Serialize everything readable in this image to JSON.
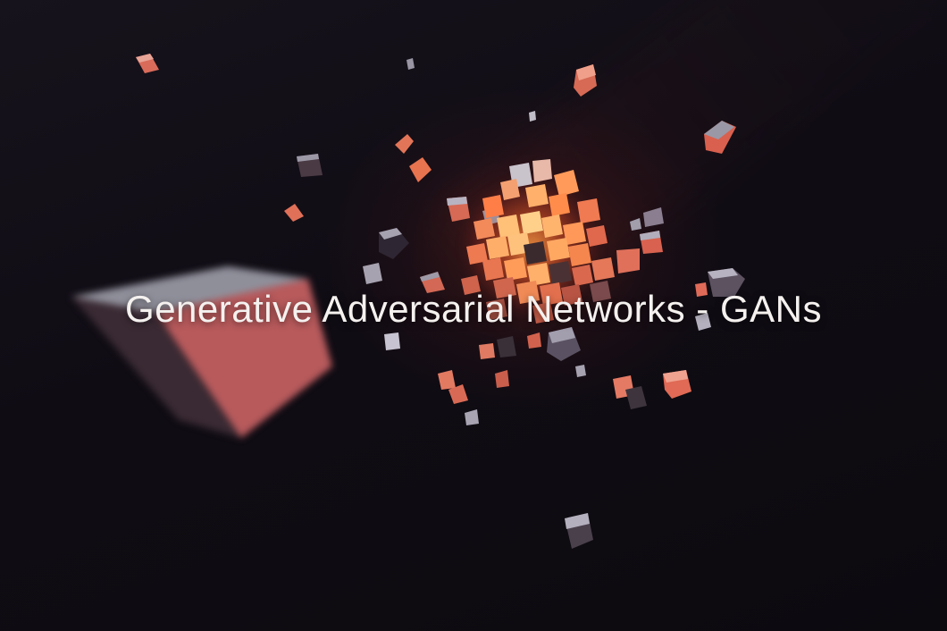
{
  "title": "Generative Adversarial Networks - GANs",
  "colors": {
    "background": "#0e0b12",
    "glow": "#ff9a4a",
    "cube_face_light": "#e07a68",
    "cube_face_dark": "#2a2230",
    "title_text": "#f4f1ef"
  }
}
